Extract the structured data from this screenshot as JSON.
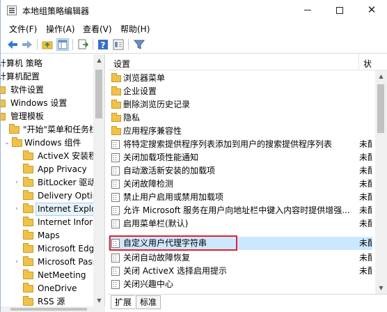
{
  "window": {
    "title": "本地组策略编辑器",
    "min_label": "",
    "close_label": "✕"
  },
  "menu": {
    "file": "文件(F)",
    "action": "操作(A)",
    "view": "查看(V)",
    "help": "帮助(H)"
  },
  "toolbar": {
    "back_icon": "arrow-left-icon",
    "forward_icon": "arrow-right-icon",
    "up_icon": "folder-up-icon",
    "show_hide_tree_icon": "console-tree-icon",
    "export_icon": "export-list-icon",
    "help_icon": "help-icon",
    "properties_icon": "properties-icon",
    "filter_icon": "filter-icon",
    "accent": "#2e7bd6"
  },
  "tree": {
    "items": [
      {
        "label": "计算机 策略",
        "level": 0,
        "expanded": true
      },
      {
        "label": "计算机配置",
        "level": 0,
        "expanded": true
      },
      {
        "label": "软件设置",
        "level": 1
      },
      {
        "label": "Windows 设置",
        "level": 1
      },
      {
        "label": "管理模板",
        "level": 1,
        "expanded": true
      },
      {
        "label": "\"开始\"菜单和任务栏",
        "level": 2
      },
      {
        "label": "Windows 组件",
        "level": 2,
        "expanded": true
      },
      {
        "label": "ActiveX 安装程序服务",
        "level": 3
      },
      {
        "label": "App Privacy",
        "level": 3
      },
      {
        "label": "BitLocker 驱动器加密",
        "level": 3,
        "has_children": true
      },
      {
        "label": "Delivery Optimization",
        "level": 3
      },
      {
        "label": "Internet Explorer",
        "level": 3,
        "has_children": true,
        "selected": true
      },
      {
        "label": "Internet Information",
        "level": 3
      },
      {
        "label": "Maps",
        "level": 3
      },
      {
        "label": "Microsoft Edge",
        "level": 3
      },
      {
        "label": "Microsoft Passport",
        "level": 3,
        "has_children": true
      },
      {
        "label": "NetMeeting",
        "level": 3
      },
      {
        "label": "OneDrive",
        "level": 3
      },
      {
        "label": "RSS 源",
        "level": 3
      }
    ]
  },
  "list": {
    "header_setting": "设置",
    "header_state": "状",
    "rows": [
      {
        "type": "folder",
        "label": "浏览器菜单",
        "state": ""
      },
      {
        "type": "folder",
        "label": "企业设置",
        "state": ""
      },
      {
        "type": "folder",
        "label": "删除浏览历史记录",
        "state": ""
      },
      {
        "type": "folder",
        "label": "隐私",
        "state": ""
      },
      {
        "type": "folder",
        "label": "应用程序兼容性",
        "state": ""
      },
      {
        "type": "setting",
        "label": "将特定搜索提供程序列表添加到用户的搜索提供程序列表",
        "state": "未配"
      },
      {
        "type": "setting",
        "label": "关闭加载项性能通知",
        "state": "未配"
      },
      {
        "type": "setting",
        "label": "自动激活新安装的加载项",
        "state": "未配"
      },
      {
        "type": "setting",
        "label": "关闭故障检测",
        "state": "未配"
      },
      {
        "type": "setting",
        "label": "禁止用户启用或禁用加载项",
        "state": "未配"
      },
      {
        "type": "setting",
        "label": "允许 Microsoft 服务在用户向地址栏中键入内容时提供增强...",
        "state": "未配"
      },
      {
        "type": "setting",
        "label": "启用菜单栏(默认)",
        "state": "未配"
      },
      {
        "type": "setting",
        "label": "自定义用户代理字符串",
        "state": "未配",
        "highlighted": true
      },
      {
        "type": "setting",
        "label": "关闭自动故障恢复",
        "state": "未配"
      },
      {
        "type": "setting",
        "label": "关闭 ActiveX 选择启用提示",
        "state": "未配"
      },
      {
        "type": "setting",
        "label": "关闭兴趣中心",
        "state": ""
      }
    ]
  },
  "tabs": {
    "expand": "扩展",
    "standard": "标准"
  },
  "colors": {
    "selection": "#cce8ff",
    "annotation": "#e0212b",
    "folder": "#f0c24a"
  }
}
